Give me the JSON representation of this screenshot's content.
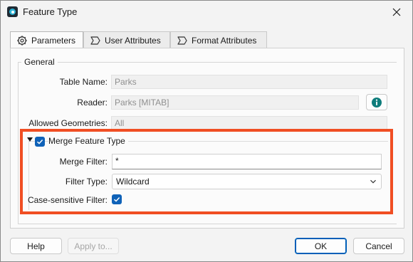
{
  "window": {
    "title": "Feature Type"
  },
  "tabs": [
    {
      "label": "Parameters",
      "icon": "gear-icon",
      "active": true
    },
    {
      "label": "User Attributes",
      "icon": "attribute-icon",
      "active": false
    },
    {
      "label": "Format Attributes",
      "icon": "attribute-icon",
      "active": false
    }
  ],
  "general": {
    "group_label": "General",
    "table_name": {
      "label": "Table Name:",
      "value": "Parks"
    },
    "reader": {
      "label": "Reader:",
      "value": "Parks [MITAB]"
    },
    "allowed_geometries": {
      "label": "Allowed Geometries:",
      "value": "All"
    }
  },
  "merge": {
    "title": "Merge Feature Type",
    "checked": true,
    "merge_filter": {
      "label": "Merge Filter:",
      "value": "*"
    },
    "filter_type": {
      "label": "Filter Type:",
      "value": "Wildcard"
    },
    "case_sensitive": {
      "label": "Case-sensitive Filter:",
      "checked": true
    }
  },
  "buttons": {
    "help": "Help",
    "apply_to": "Apply to...",
    "ok": "OK",
    "cancel": "Cancel"
  },
  "colors": {
    "highlight": "#f04e23",
    "checkbox": "#0f62b8",
    "info": "#0e7c7b"
  }
}
